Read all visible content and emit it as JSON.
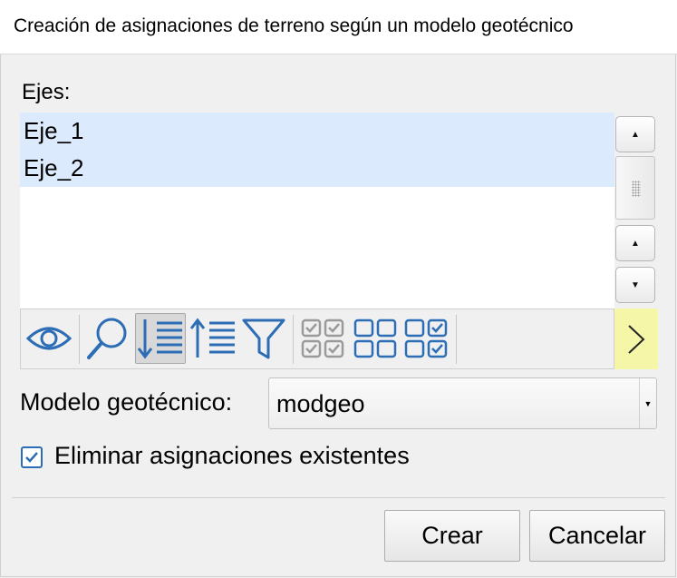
{
  "window": {
    "title": "Creación de asignaciones de terreno según un modelo geotécnico"
  },
  "axes": {
    "label": "Ejes:",
    "items": [
      {
        "label": "Eje_1",
        "selected": true
      },
      {
        "label": "Eje_2",
        "selected": true
      }
    ]
  },
  "toolbar": {
    "icons": [
      "eye-icon",
      "magnifier-icon",
      "sort-descending-icon",
      "sort-ascending-icon",
      "filter-icon",
      "check-all-icon",
      "uncheck-all-icon",
      "invert-check-icon",
      "next-page-icon"
    ],
    "active_tool": "sort-descending-icon"
  },
  "geo_model": {
    "label": "Modelo geotécnico:",
    "value": "modgeo"
  },
  "delete_existing": {
    "label": "Eliminar asignaciones existentes",
    "checked": true
  },
  "buttons": {
    "create": "Crear",
    "cancel": "Cancelar"
  },
  "colors": {
    "selection": "#dbeafc",
    "icon_blue": "#2d6db5",
    "next_button": "#f5f6a8",
    "disabled_icon": "#9a9a9a"
  }
}
